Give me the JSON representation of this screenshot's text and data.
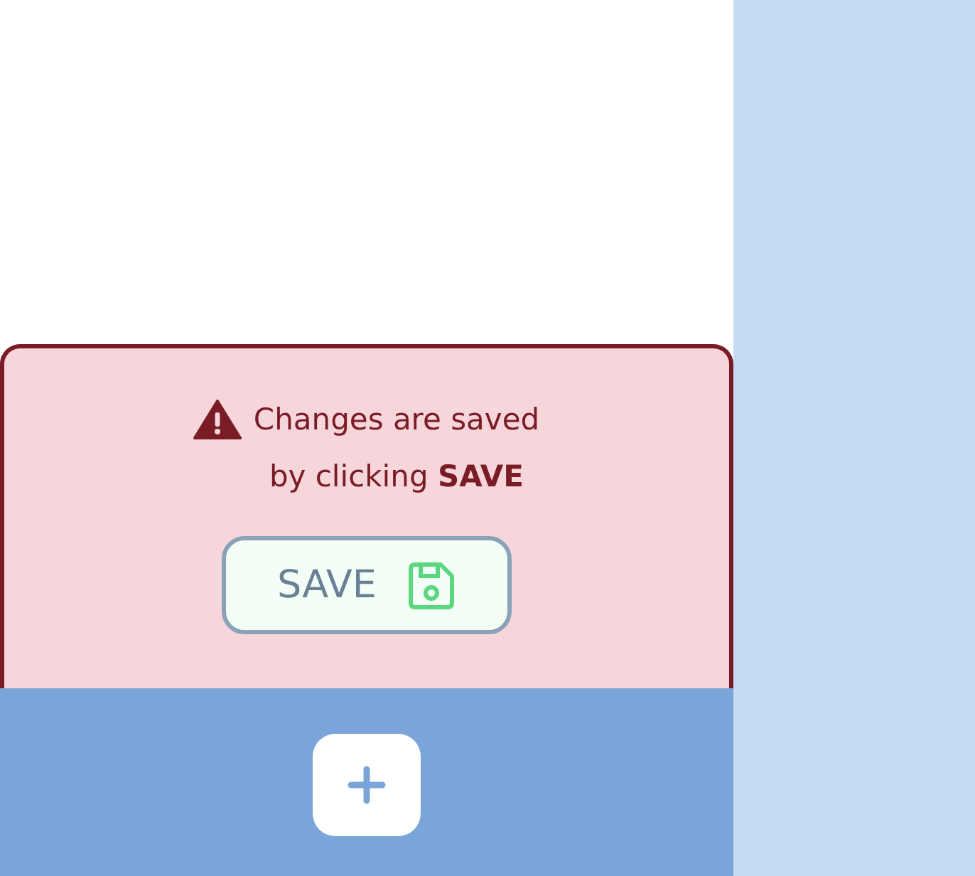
{
  "notice": {
    "message": "Changes are saved\nby clicking **SAVE**"
  },
  "save_button": {
    "label": "SAVE"
  }
}
